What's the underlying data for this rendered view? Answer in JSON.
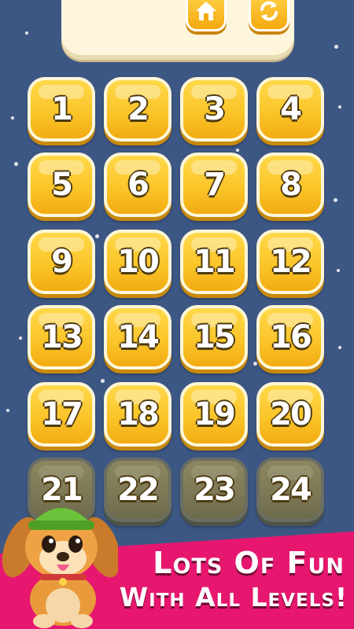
{
  "toolbar": {
    "home_icon": "home-icon",
    "restart_icon": "restart-icon"
  },
  "levels": [
    {
      "label": "1",
      "locked": false
    },
    {
      "label": "2",
      "locked": false
    },
    {
      "label": "3",
      "locked": false
    },
    {
      "label": "4",
      "locked": false
    },
    {
      "label": "5",
      "locked": false
    },
    {
      "label": "6",
      "locked": false
    },
    {
      "label": "7",
      "locked": false
    },
    {
      "label": "8",
      "locked": false
    },
    {
      "label": "9",
      "locked": false
    },
    {
      "label": "10",
      "locked": false
    },
    {
      "label": "11",
      "locked": false
    },
    {
      "label": "12",
      "locked": false
    },
    {
      "label": "13",
      "locked": false
    },
    {
      "label": "14",
      "locked": false
    },
    {
      "label": "15",
      "locked": false
    },
    {
      "label": "16",
      "locked": false
    },
    {
      "label": "17",
      "locked": false
    },
    {
      "label": "18",
      "locked": false
    },
    {
      "label": "19",
      "locked": false
    },
    {
      "label": "20",
      "locked": false
    },
    {
      "label": "21",
      "locked": true
    },
    {
      "label": "22",
      "locked": true
    },
    {
      "label": "23",
      "locked": true
    },
    {
      "label": "24",
      "locked": true
    }
  ],
  "banner": {
    "line1": "Lots Of Fun",
    "line2": "With All Levels!"
  },
  "colors": {
    "background": "#3d5785",
    "button_gold": "#fbc52a",
    "button_locked": "#7c7756",
    "banner": "#e7176f"
  }
}
